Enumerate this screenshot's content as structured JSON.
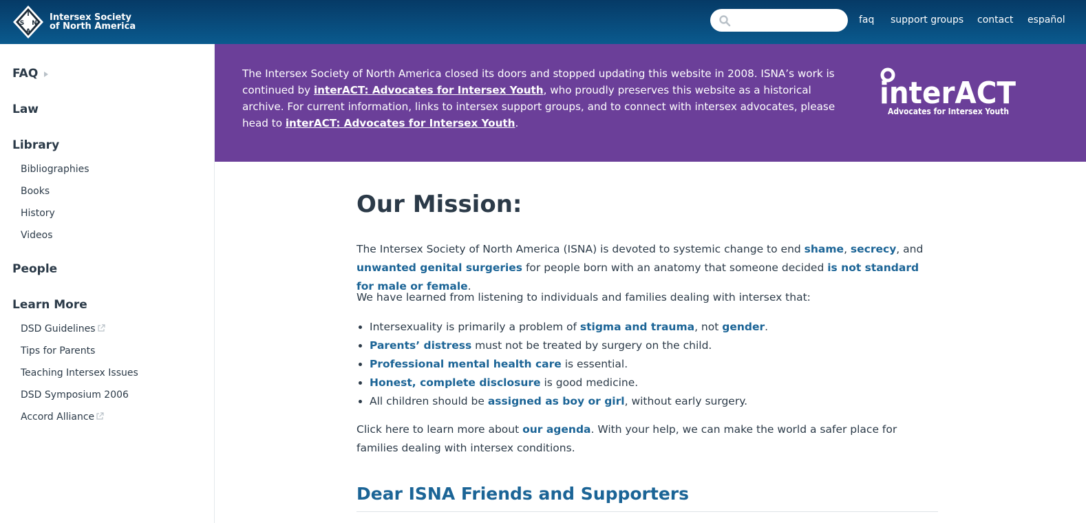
{
  "header": {
    "logo": {
      "letters": [
        "I",
        "S",
        "N",
        "A"
      ],
      "line1": "Intersex Society",
      "line2": "of North America"
    },
    "search": {
      "placeholder": "",
      "value": "",
      "icon": "search-icon"
    },
    "nav": [
      {
        "label": "faq"
      },
      {
        "label": "support groups"
      },
      {
        "label": "contact"
      },
      {
        "label": "español"
      }
    ]
  },
  "sidebar": {
    "faq": "FAQ",
    "law": "Law",
    "library": "Library",
    "library_items": [
      "Bibliographies",
      "Books",
      "History",
      "Videos"
    ],
    "people": "People",
    "learn_more": "Learn More",
    "learn_more_items": [
      "DSD Guidelines",
      "Tips for Parents",
      "Teaching Intersex Issues",
      "DSD Symposium 2006",
      "Accord Alliance"
    ]
  },
  "banner": {
    "text1": "The Intersex Society of North America closed its doors and stopped updating this website in 2008. ISNA’s work is continued by ",
    "link1": "interACT: Advocates for Intersex Youth",
    "text2": ", who proudly preserves this website as a historical archive. For current information, links to intersex support groups, and to connect with intersex advocates, please head to ",
    "link2": "interACT: Advocates for Intersex Youth",
    "text3": ".",
    "logo_wordmark": "interACT",
    "logo_tagline": "Advocates for Intersex Youth"
  },
  "main": {
    "title": "Our Mission:",
    "p1": {
      "t1": "The Intersex Society of North America (ISNA) is devoted to systemic change to end ",
      "l1": "shame",
      "t2": ", ",
      "l2": "secrecy",
      "t3": ", and ",
      "l3": "unwanted genital surgeries",
      "t4": " for people born with an anatomy that someone decided ",
      "l4": "is not standard for male or female",
      "t5": "."
    },
    "p2": "We have learned from listening to individuals and families dealing with intersex that:",
    "bullets": [
      {
        "t1": "Intersexuality is primarily a problem of ",
        "l1": "stigma and trauma",
        "t2": ", not ",
        "l2": "gender",
        "t3": "."
      },
      {
        "l1": "Parents’ distress",
        "t1": " must not be treated by surgery on the child."
      },
      {
        "l1": "Professional mental health care",
        "t1": " is essential."
      },
      {
        "l1": "Honest, complete disclosure",
        "t1": " is good medicine."
      },
      {
        "t1": "All children should be ",
        "l1": "assigned as boy or girl",
        "t2": ", without early surgery."
      }
    ],
    "p3": {
      "t1": "Click here to learn more about ",
      "l1": "our agenda",
      "t2": ". With your help, we can make the world a safer place for families dealing with intersex conditions."
    },
    "subheading": "Dear ISNA Friends and Supporters"
  }
}
